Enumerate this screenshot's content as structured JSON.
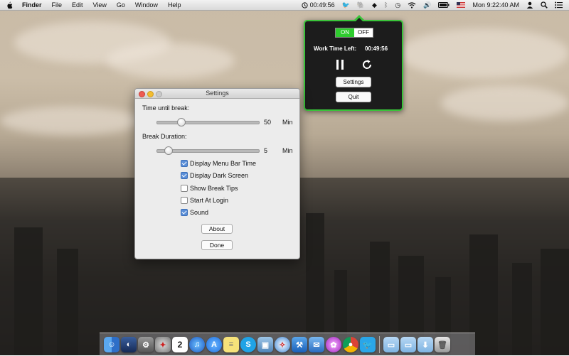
{
  "menubar": {
    "app_name": "Finder",
    "menus": [
      "File",
      "Edit",
      "View",
      "Go",
      "Window",
      "Help"
    ],
    "timer": "00:49:56",
    "clock": "Mon 9:22:40 AM"
  },
  "popover": {
    "toggle_on": "ON",
    "toggle_off": "OFF",
    "work_time_label": "Work Time Left:",
    "work_time_value": "00:49:56",
    "settings_label": "Settings",
    "quit_label": "Quit"
  },
  "settings": {
    "title": "Settings",
    "time_until_break_label": "Time until break:",
    "time_until_break_value": "50",
    "time_until_break_unit": "Min",
    "time_until_break_fraction": 0.22,
    "break_duration_label": "Break Duration:",
    "break_duration_value": "5",
    "break_duration_unit": "Min",
    "break_duration_fraction": 0.08,
    "checkboxes": [
      {
        "label": "Display Menu Bar Time",
        "checked": true
      },
      {
        "label": "Display Dark Screen",
        "checked": true
      },
      {
        "label": "Show Break Tips",
        "checked": false
      },
      {
        "label": "Start At Login",
        "checked": false
      },
      {
        "label": "Sound",
        "checked": true
      }
    ],
    "about_label": "About",
    "done_label": "Done"
  },
  "dock": {
    "items": [
      "finder-icon",
      "dashboard-icon",
      "mission-control-icon",
      "launchpad-icon",
      "calendar-icon",
      "itunes-icon",
      "app-store-icon",
      "notes-icon",
      "skype-icon",
      "preview-icon",
      "safari-icon",
      "xcode-icon",
      "mail-icon",
      "flower-icon",
      "chrome-icon",
      "twitter-icon",
      "folder-icon",
      "folder-icon",
      "downloads-icon",
      "trash-icon"
    ],
    "calendar_day": "2"
  }
}
